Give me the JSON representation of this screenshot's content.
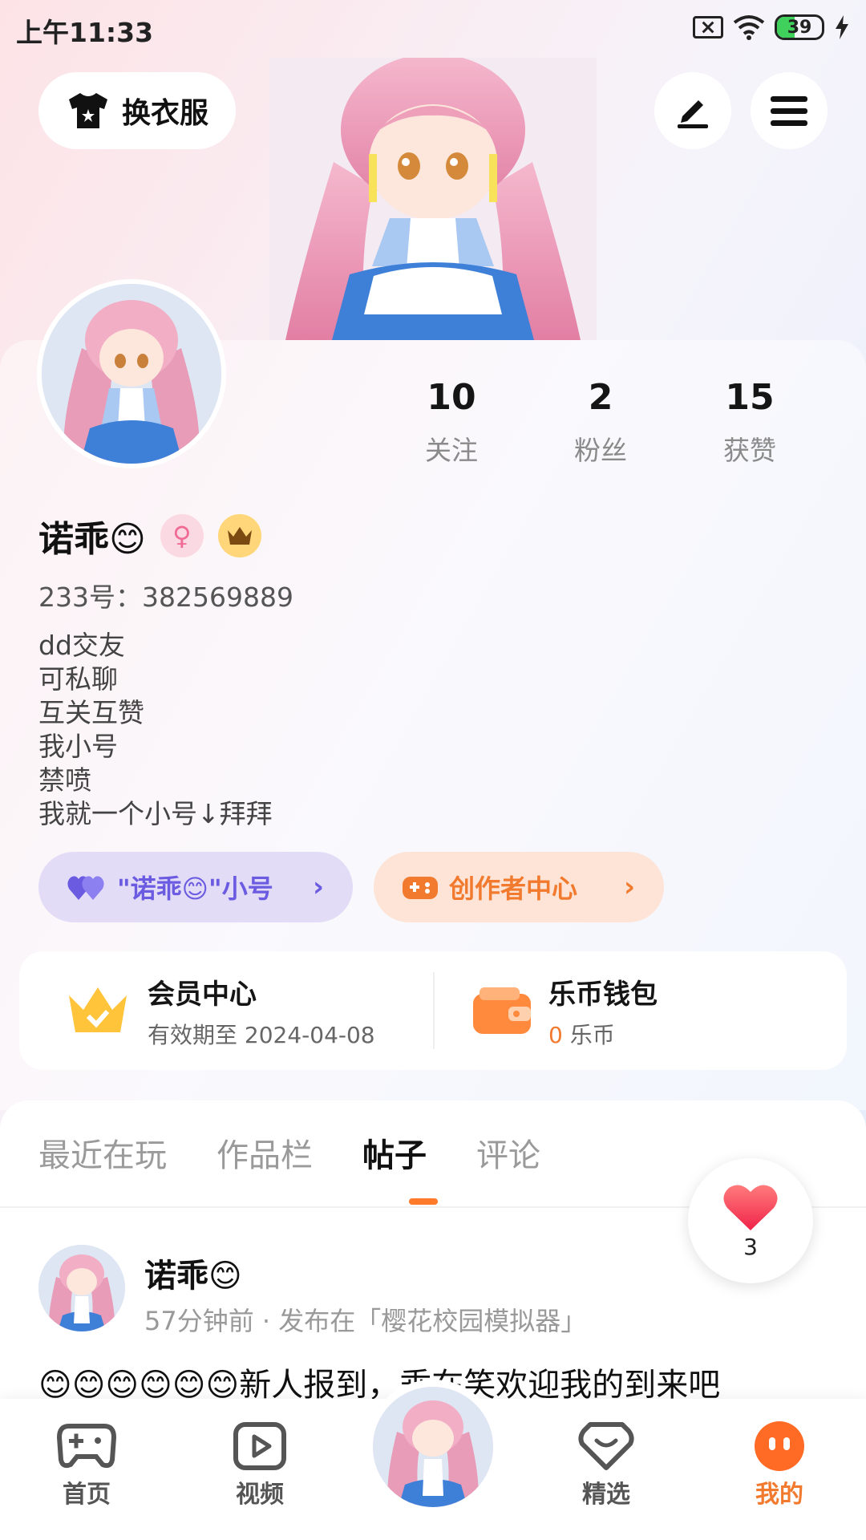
{
  "status_bar": {
    "time": "上午11:33",
    "battery": "39"
  },
  "top": {
    "dress_label": "换衣服"
  },
  "stats": [
    {
      "value": "10",
      "label": "关注"
    },
    {
      "value": "2",
      "label": "粉丝"
    },
    {
      "value": "15",
      "label": "获赞"
    }
  ],
  "profile": {
    "name": "诺乖😊",
    "gender_symbol": "♀",
    "uid": "233号：382569889",
    "bio": [
      "dd交友",
      "可私聊",
      "互关互赞",
      "我小号",
      "禁喷",
      "我就一个小号↓拜拜"
    ]
  },
  "pills": {
    "alt_account": "\"诺乖😊\"小号",
    "creator": "创作者中心"
  },
  "member": {
    "title": "会员中心",
    "subtitle": "有效期至 2024-04-08"
  },
  "wallet": {
    "title": "乐币钱包",
    "amount": "0",
    "unit": "乐币"
  },
  "tabs": [
    "最近在玩",
    "作品栏",
    "帖子",
    "评论"
  ],
  "like_count": "3",
  "post": {
    "author": "诺乖😊",
    "meta": "57分钟前 · 发布在「樱花校园模拟器」",
    "text": "😊😊😊😊😊😊新人报到，乖在笑欢迎我的到来吧"
  },
  "nav": [
    "首页",
    "视频",
    "精选",
    "我的"
  ],
  "colors": {
    "accent": "#f27a2e",
    "purple": "#6a5be0",
    "tab_indicator": "#ff7a2b"
  }
}
